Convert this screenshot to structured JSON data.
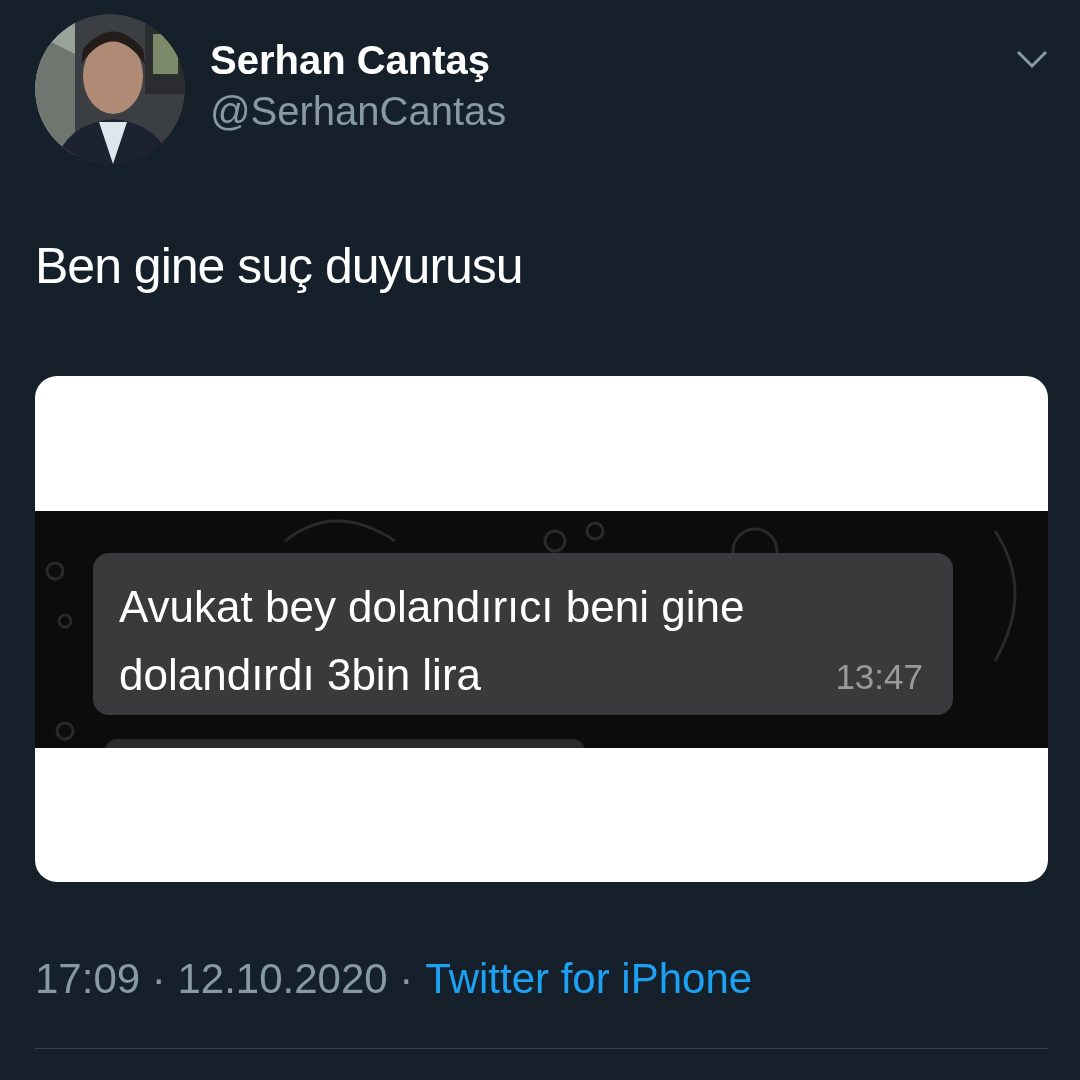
{
  "author": {
    "name": "Serhan Cantaş",
    "handle": "@SerhanCantas"
  },
  "tweet": {
    "text": "Ben gine suç duyurusu"
  },
  "media": {
    "kind": "chat_screenshot",
    "message": {
      "text": "Avukat bey dolandırıcı beni gine dolandırdı 3bin lira",
      "time": "13:47"
    }
  },
  "footer": {
    "timestamp": "17:09 · 12.10.2020 ·",
    "source": "Twitter for iPhone"
  }
}
